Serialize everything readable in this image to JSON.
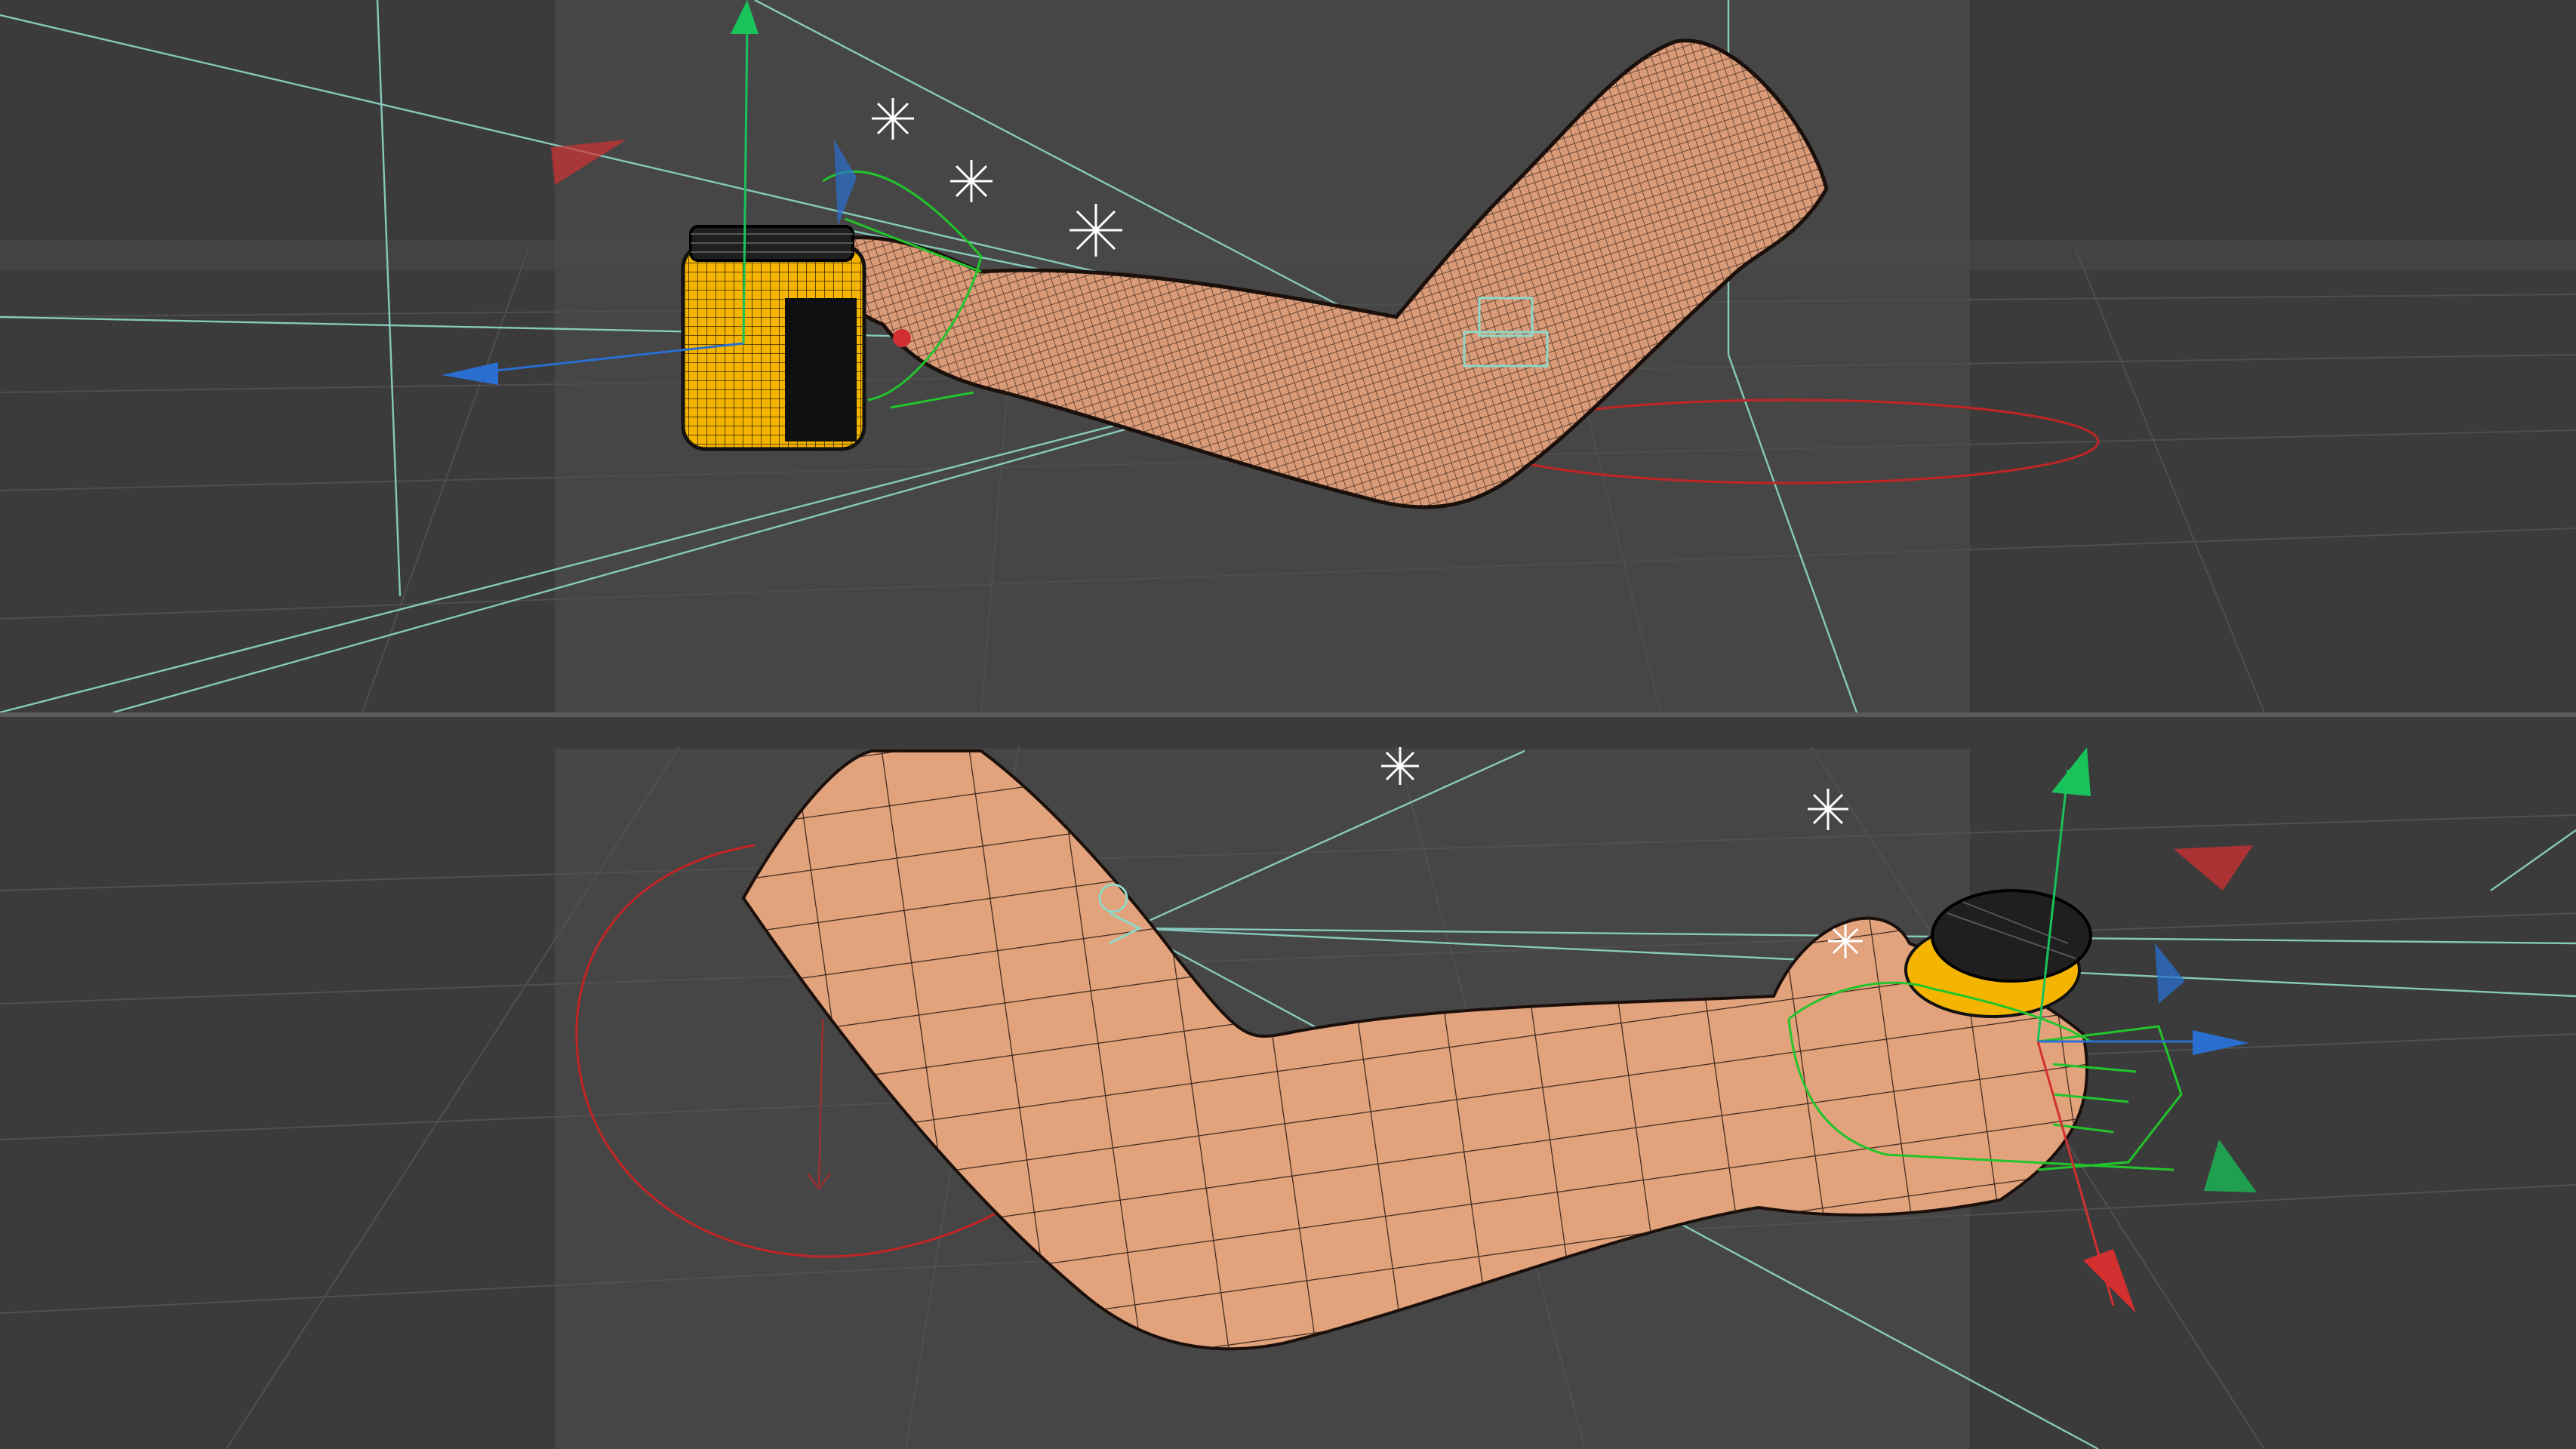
{
  "app": {
    "viewports": [
      {
        "id": "top",
        "view_name": "",
        "shading": "wireframe-shaded"
      },
      {
        "id": "bottom",
        "view_name": "",
        "shading": "gouraud-lines"
      }
    ]
  },
  "scene": {
    "objects": [
      {
        "name": "",
        "kind": "arm-mesh",
        "color": "#d99a78"
      },
      {
        "name": "",
        "kind": "jar-mesh",
        "color": "#f4b400"
      },
      {
        "name": "",
        "kind": "hand-controller",
        "color": "#22c52c"
      },
      {
        "name": "",
        "kind": "ik-circle",
        "color": "#c42424"
      }
    ],
    "lights": [
      {
        "icon": "light-icon"
      },
      {
        "icon": "light-icon"
      },
      {
        "icon": "light-icon"
      },
      {
        "icon": "light-icon"
      },
      {
        "icon": "light-icon"
      }
    ],
    "axis_colors": {
      "x": "#d23030",
      "y": "#19c25a",
      "z": "#2a6fd0"
    }
  },
  "colors": {
    "background": "#3b3b3b",
    "safe_frame": "#494949",
    "grid": "#555555",
    "camera_lines": "#8fd8c8",
    "skin": "#d99a78",
    "mesh_lines": "#2a1a12",
    "jar": "#f4b400",
    "lid": "#2b2b2b"
  }
}
